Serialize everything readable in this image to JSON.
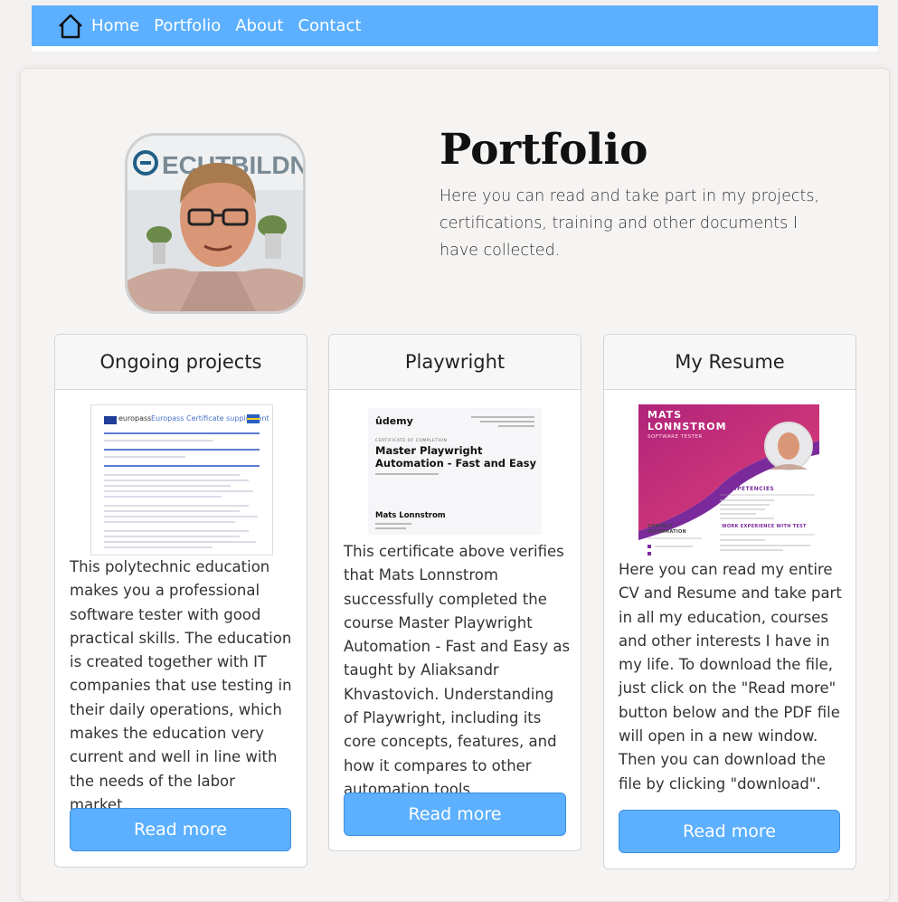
{
  "nav": {
    "items": [
      "Home",
      "Portfolio",
      "About",
      "Contact"
    ]
  },
  "hero": {
    "avatar_sign": "ECUTBILDNING",
    "title": "Portfolio",
    "text": "Here you can read and take part in my projects, certifications, training and other documents I have collected."
  },
  "cards": [
    {
      "title": "Ongoing projects",
      "thumb": {
        "brand": "europass",
        "heading": "Europass Certificate supplement"
      },
      "text": "This polytechnic education makes you a professional software tester with good practical skills. The education is created together with IT companies that use testing in their daily operations, which makes the education very current and well in line with the needs of the labor market.",
      "button": "Read more"
    },
    {
      "title": "Playwright",
      "thumb": {
        "brand": "ûdemy",
        "kicker": "CERTIFICATE OF COMPLETION",
        "course": "Master Playwright Automation - Fast and Easy",
        "name": "Mats Lonnstrom"
      },
      "text": "This certificate above verifies that Mats Lonnstrom successfully completed the course Master Playwright Automation - Fast and Easy as taught by Aliaksandr Khvastovich. Understanding of Playwright, including its core concepts, features, and how it compares to other automation tools.",
      "button": "Read more"
    },
    {
      "title": "My Resume",
      "thumb": {
        "name": "MATS LONNSTROM",
        "role": "SOFTWARE TESTER",
        "section1": "COMPETENCIES",
        "section2": "WORK EXPERIENCE WITH TEST",
        "contact": "CONTACT INFORMATION"
      },
      "text": "Here you can read my entire CV and Resume and take part in all my education, courses and other interests I have in my life. To download the file, just click on the \"Read more\" button below and the PDF file will open in a new window. Then you can download the file by clicking \"download\".",
      "button": "Read more"
    }
  ],
  "colors": {
    "accent": "#5cb0ff",
    "background": "#f3f1f0",
    "card": "#ffffff"
  }
}
